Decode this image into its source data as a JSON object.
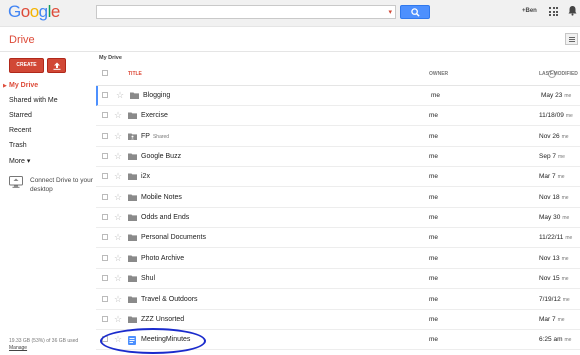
{
  "header": {
    "logo_text": "Google",
    "user_name": "+Ben",
    "colors": {
      "blue": "#4285f4",
      "red": "#dd4b39",
      "yellow": "#f4b400",
      "green": "#0f9d58",
      "accent_red": "#d14836",
      "search_blue": "#4d90fe",
      "circle": "#1a2bcc"
    }
  },
  "drive_bar": {
    "title": "Drive"
  },
  "toolbar": {
    "create_label": "CREATE"
  },
  "sidebar": {
    "items": [
      {
        "label": "My Drive",
        "active": true
      },
      {
        "label": "Shared with Me"
      },
      {
        "label": "Starred"
      },
      {
        "label": "Recent"
      },
      {
        "label": "Trash"
      },
      {
        "label": "More ▾"
      }
    ],
    "connect_text": "Connect Drive to your desktop",
    "storage_text": "19.33 GB (53%) of 36 GB used",
    "manage_label": "Manage"
  },
  "breadcrumb": "My Drive",
  "table": {
    "headers": {
      "title": "TITLE",
      "owner": "OWNER",
      "modified": "LAST MODIFIED"
    },
    "rows": [
      {
        "name": "Blogging",
        "shared": "",
        "owner": "me",
        "modified": "May 23",
        "by": "me",
        "icon": "folder-icon"
      },
      {
        "name": "Exercise",
        "shared": "",
        "owner": "me",
        "modified": "11/18/09",
        "by": "me",
        "icon": "folder-icon"
      },
      {
        "name": "FP",
        "shared": "Shared",
        "owner": "me",
        "modified": "Nov 26",
        "by": "me",
        "icon": "shared-folder-icon"
      },
      {
        "name": "Google Buzz",
        "shared": "",
        "owner": "me",
        "modified": "Sep 7",
        "by": "me",
        "icon": "folder-icon"
      },
      {
        "name": "i2x",
        "shared": "",
        "owner": "me",
        "modified": "Mar 7",
        "by": "me",
        "icon": "folder-icon"
      },
      {
        "name": "Mobile Notes",
        "shared": "",
        "owner": "me",
        "modified": "Nov 18",
        "by": "me",
        "icon": "folder-icon"
      },
      {
        "name": "Odds and Ends",
        "shared": "",
        "owner": "me",
        "modified": "May 30",
        "by": "me",
        "icon": "folder-icon"
      },
      {
        "name": "Personal Documents",
        "shared": "",
        "owner": "me",
        "modified": "11/22/11",
        "by": "me",
        "icon": "folder-icon"
      },
      {
        "name": "Photo Archive",
        "shared": "",
        "owner": "me",
        "modified": "Nov 13",
        "by": "me",
        "icon": "folder-icon"
      },
      {
        "name": "Shul",
        "shared": "",
        "owner": "me",
        "modified": "Nov 15",
        "by": "me",
        "icon": "folder-icon"
      },
      {
        "name": "Travel & Outdoors",
        "shared": "",
        "owner": "me",
        "modified": "7/19/12",
        "by": "me",
        "icon": "folder-icon"
      },
      {
        "name": "ZZZ Unsorted",
        "shared": "",
        "owner": "me",
        "modified": "Mar 7",
        "by": "me",
        "icon": "folder-icon"
      },
      {
        "name": "MeetingMinutes",
        "shared": "",
        "owner": "me",
        "modified": "6:25 am",
        "by": "me",
        "icon": "document-icon"
      }
    ]
  }
}
